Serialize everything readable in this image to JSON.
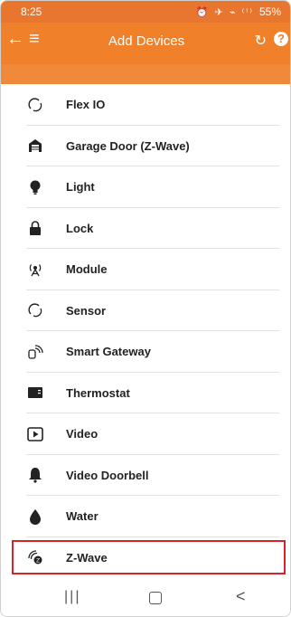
{
  "status": {
    "time": "8:25",
    "icons": "⏰ ✈ ⌁ ⁽ⁱ⁾",
    "battery": "55%"
  },
  "appbar": {
    "title": "Add Devices",
    "back_icon": "arrow-left-icon",
    "menu_icon": "hamburger-icon",
    "refresh_icon": "refresh-icon",
    "help_icon": "help-icon"
  },
  "items": [
    {
      "label": "Flex IO",
      "icon": "flex-io-icon"
    },
    {
      "label": "Garage Door (Z-Wave)",
      "icon": "garage-door-icon"
    },
    {
      "label": "Light",
      "icon": "light-bulb-icon"
    },
    {
      "label": "Lock",
      "icon": "lock-icon"
    },
    {
      "label": "Module",
      "icon": "module-icon"
    },
    {
      "label": "Sensor",
      "icon": "sensor-icon"
    },
    {
      "label": "Smart Gateway",
      "icon": "smart-gateway-icon"
    },
    {
      "label": "Thermostat",
      "icon": "thermostat-icon"
    },
    {
      "label": "Video",
      "icon": "video-icon"
    },
    {
      "label": "Video Doorbell",
      "icon": "doorbell-icon"
    },
    {
      "label": "Water",
      "icon": "water-drop-icon"
    },
    {
      "label": "Z-Wave",
      "icon": "z-wave-icon"
    }
  ],
  "selected_item": "Z-Wave",
  "colors": {
    "accent": "#f0812a",
    "highlight": "#d9232b"
  }
}
